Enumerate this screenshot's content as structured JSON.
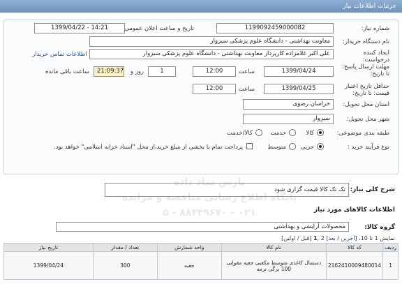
{
  "page": {
    "title": "جزئیات اطلاعات نیاز"
  },
  "form": {
    "need_number_label": "شماره نیاز:",
    "need_number": "1199092459000082",
    "announce_label": "تاریخ و ساعت اعلان عمومی:",
    "announce_value": "1399/04/22 - 14:21",
    "buyer_org_label": "نام دستگاه خریدار:",
    "buyer_org": "معاونت بهداشتی - دانشگاه علوم پزشکی سبزوار",
    "creator_label": "ایجاد کننده درخواست:",
    "creator": "علی اکبر غلامزاده کارپرداز معاونت بهداشتی - دانشگاه علوم پزشکی سبزوار",
    "contact_link": "اطلاعات تماس خریدار",
    "reply_deadline_label": "مهلت ارسال پاسخ: تا تاریخ:",
    "reply_date": "1399/04/24",
    "time_label": "ساعت",
    "reply_time": "12:00",
    "days_value": "1",
    "day_label": "روز و",
    "remaining_time": "21:09:37",
    "remaining_label": "ساعت باقی مانده",
    "validity_label": "حداقل تاریخ اعتبار قیمت: تا تاریخ:",
    "validity_date": "1399/04/25",
    "validity_time": "12:00",
    "province_label": "استان محل تحویل:",
    "province": "خراسان رضوی",
    "city_label": "شهر محل تحویل:",
    "city": "سبزوار",
    "category_label": "طبقه بندی موضوعی:",
    "category_options": [
      "کالا",
      "خدمت",
      "کالا/خدمت"
    ],
    "process_label": "نوع فرآیند خرید :",
    "process_options": [
      "جزیی",
      "متوسط"
    ],
    "payment_note": "پرداخت تمام یا بخشی از مبلغ خرید،از محل \"اسناد خزانه اسلامی\" خواهد بود."
  },
  "description": {
    "label": "شرح کلی نیاز:",
    "value": "تک تک کالا قیمت گزاری شود"
  },
  "goods": {
    "title": "اطلاعات کالاهای مورد نیاز",
    "group_label": "گروه کالا:",
    "group_value": "محصولات آرایشی و بهداشتی",
    "pagination_prefix": "نمایش 1 تا 10، [",
    "pagination_last": "آخرین",
    "pagination_sep1": " / ",
    "pagination_next": "بعد",
    "pagination_mid": "] 2 ,",
    "pagination_current": "1",
    "pagination_suffix": " [قبل / اولین]"
  },
  "table": {
    "headers": [
      "ردیف",
      "کد کالا",
      "نام کالا",
      "واحد شمارش",
      "تعداد / مقدار",
      "تاریخ نیاز"
    ],
    "rows": [
      {
        "row": "1",
        "code": "2162410009480014",
        "name": "دستمال کاغذی متوسط مکعبی جعبه مقوایی 100 برگی نرمه",
        "unit": "جعبه",
        "qty": "300",
        "date": "1399/04/24"
      }
    ]
  },
  "watermark": {
    "line1": "پارس نماد داده",
    "line2": "پایگاه اطلاع رسانی مناقصه و مزایده",
    "line3": "۰۲۱ - ۸۸۳۴۹۶۷۰ - ۵"
  }
}
